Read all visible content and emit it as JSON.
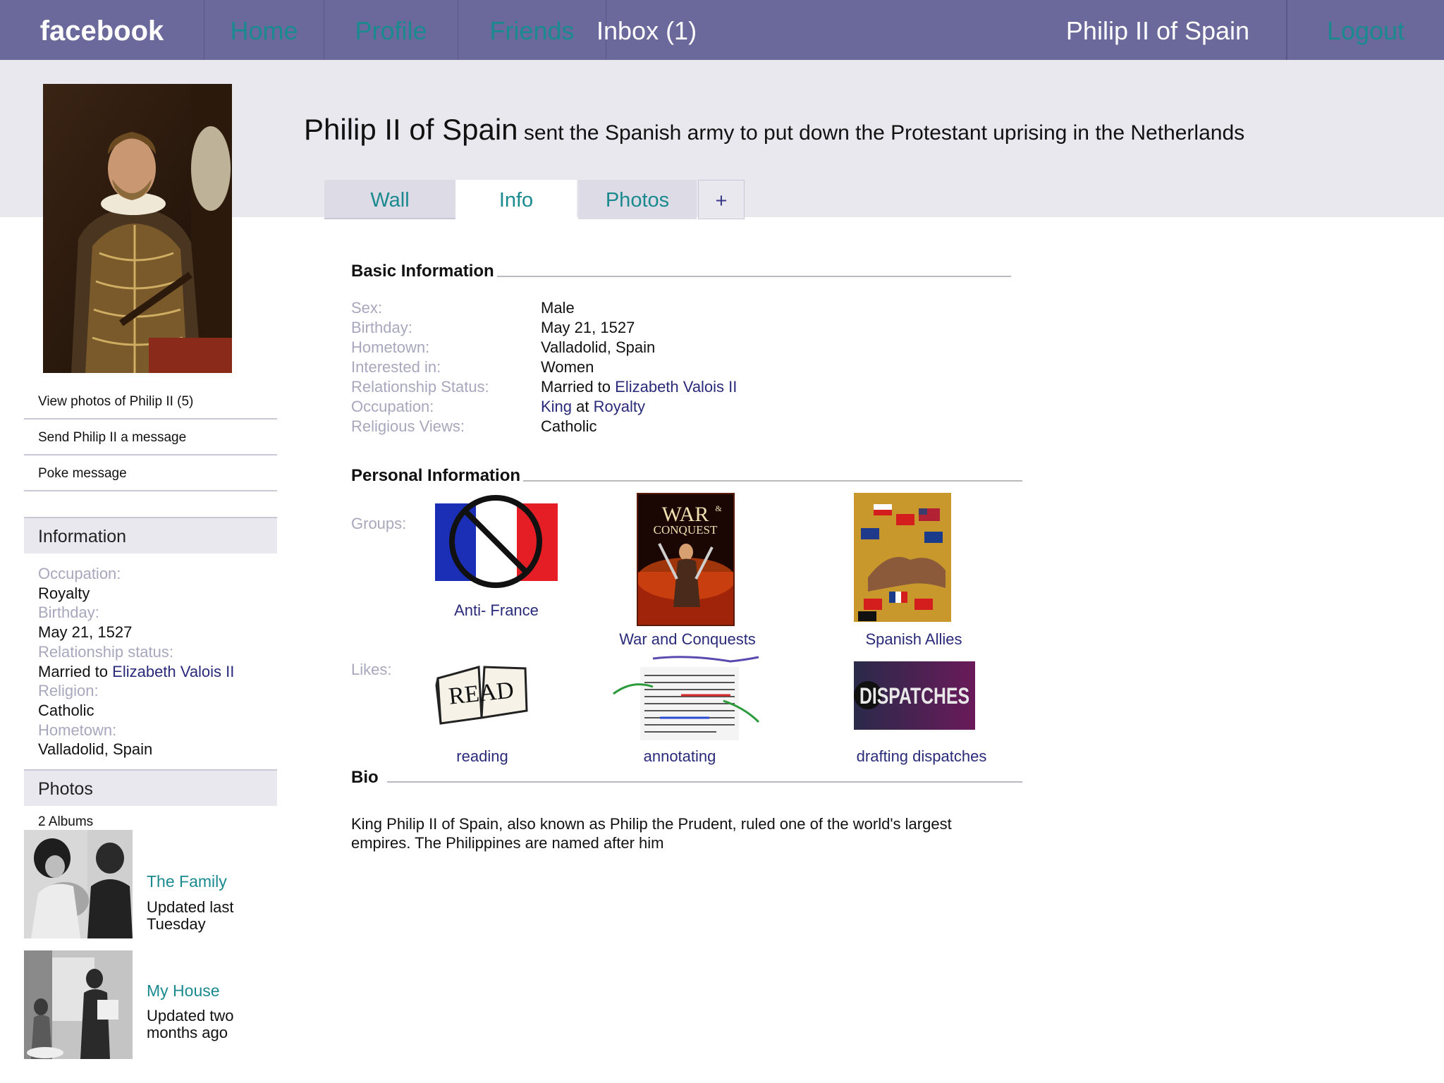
{
  "topbar": {
    "brand": "facebook",
    "nav": {
      "home": "Home",
      "profile": "Profile",
      "friends": "Friends",
      "inbox": "Inbox (1)"
    },
    "user": "Philip II of Spain",
    "logout": "Logout"
  },
  "profile": {
    "name": "Philip II of Spain",
    "status": "sent the Spanish army to put down the Protestant uprising in the Netherlands"
  },
  "tabs": {
    "wall": "Wall",
    "info": "Info",
    "photos": "Photos",
    "plus": "+"
  },
  "sidebar": {
    "links": [
      "View photos of Philip II (5)",
      "Send Philip II a message",
      "Poke message"
    ],
    "information_header": "Information",
    "info": [
      {
        "label": "Occupation:",
        "value": "Royalty"
      },
      {
        "label": "Birthday:",
        "value": "May 21, 1527"
      },
      {
        "label": "Relationship status:",
        "value_prefix": "Married to ",
        "value_link": "Elizabeth Valois II"
      },
      {
        "label": "Religion:",
        "value": "Catholic"
      },
      {
        "label": "Hometown:",
        "value": "Valladolid, Spain"
      }
    ],
    "photos_header": "Photos",
    "albums_count": "2 Albums",
    "albums": [
      {
        "title": "The Family",
        "updated": "Updated last Tuesday"
      },
      {
        "title": "My House",
        "updated": "Updated two months ago"
      }
    ]
  },
  "basic_info": {
    "title": "Basic Information",
    "rows": [
      {
        "key": "Sex:",
        "value": "Male"
      },
      {
        "key": "Birthday:",
        "value": "May 21, 1527"
      },
      {
        "key": "Hometown:",
        "value_link": "Valladolid, Spain"
      },
      {
        "key": "Interested in:",
        "value": "Women"
      },
      {
        "key": "Relationship Status:",
        "value_prefix": "Married to ",
        "value_link": "Elizabeth Valois II"
      },
      {
        "key": "Occupation:",
        "value_link": "King",
        "value_mid": " at ",
        "value_link2": "Royalty"
      },
      {
        "key": "Religious Views:",
        "value_link": "Catholic"
      }
    ]
  },
  "personal_info": {
    "title": "Personal Information",
    "groups_label": "Groups:",
    "groups": [
      "Anti- France",
      "War and Conquests",
      "Spanish Allies"
    ],
    "likes_label": "Likes:",
    "likes": [
      "reading",
      "annotating",
      "drafting dispatches"
    ],
    "war_cover_title_1": "WAR",
    "war_cover_amp": "&",
    "war_cover_title_2": "CONQUEST",
    "read_text": "READ",
    "dispatches_text": "DISPATCHES"
  },
  "bio": {
    "title": "Bio",
    "text": "King Philip II of Spain, also known as Philip the Prudent, ruled one of the world's largest empires. The Philippines are named after him"
  },
  "colors": {
    "topbar": "#6b689c",
    "header_band": "#e9e8ef",
    "link_teal": "#1a8a8f",
    "link_navy": "#2a2a7a",
    "label_gray": "#a8a7bd"
  }
}
